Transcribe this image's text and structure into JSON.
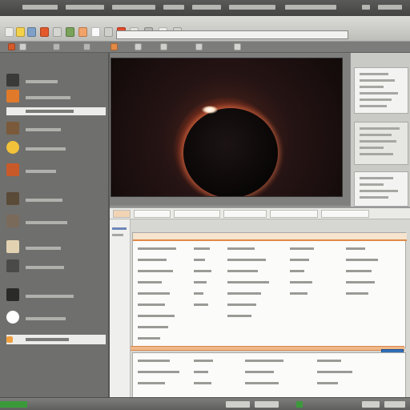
{
  "window": {
    "title": ""
  },
  "menubar": {
    "items": [
      "",
      "",
      "",
      "",
      "",
      "",
      ""
    ]
  },
  "toolbar": {
    "address_text": ""
  },
  "sidebar": {
    "items": [
      {
        "label": "",
        "selected": false,
        "thumb_color": "#3a3a38"
      },
      {
        "label": "",
        "selected": false,
        "thumb_color": "#e07a2a"
      },
      {
        "label": "",
        "selected": true,
        "thumb_color": "#ffffff"
      },
      {
        "label": "",
        "selected": false,
        "thumb_color": "#7a5a3a"
      },
      {
        "label": "",
        "selected": false,
        "thumb_color": "#f1c23a"
      },
      {
        "label": "",
        "selected": false,
        "thumb_color": "#c85a2a"
      },
      {
        "label": "",
        "selected": false,
        "thumb_color": "#5a4a38"
      },
      {
        "label": "",
        "selected": false,
        "thumb_color": "#7a6a5a"
      },
      {
        "label": "",
        "selected": false,
        "thumb_color": "#e2d2b2"
      },
      {
        "label": "",
        "selected": false,
        "thumb_color": "#4a4a48"
      },
      {
        "label": "",
        "selected": false,
        "thumb_color": "#2a2a28"
      },
      {
        "label": "",
        "selected": false,
        "thumb_color": "#ffffff"
      },
      {
        "label": "",
        "selected": true,
        "thumb_color": "#f0a040"
      }
    ]
  },
  "viewer": {
    "image_name": "solar-eclipse"
  },
  "colors": {
    "accent_orange": "#e08a45",
    "accent_blue": "#2f6fb8",
    "status_green": "#3a9a3a"
  }
}
